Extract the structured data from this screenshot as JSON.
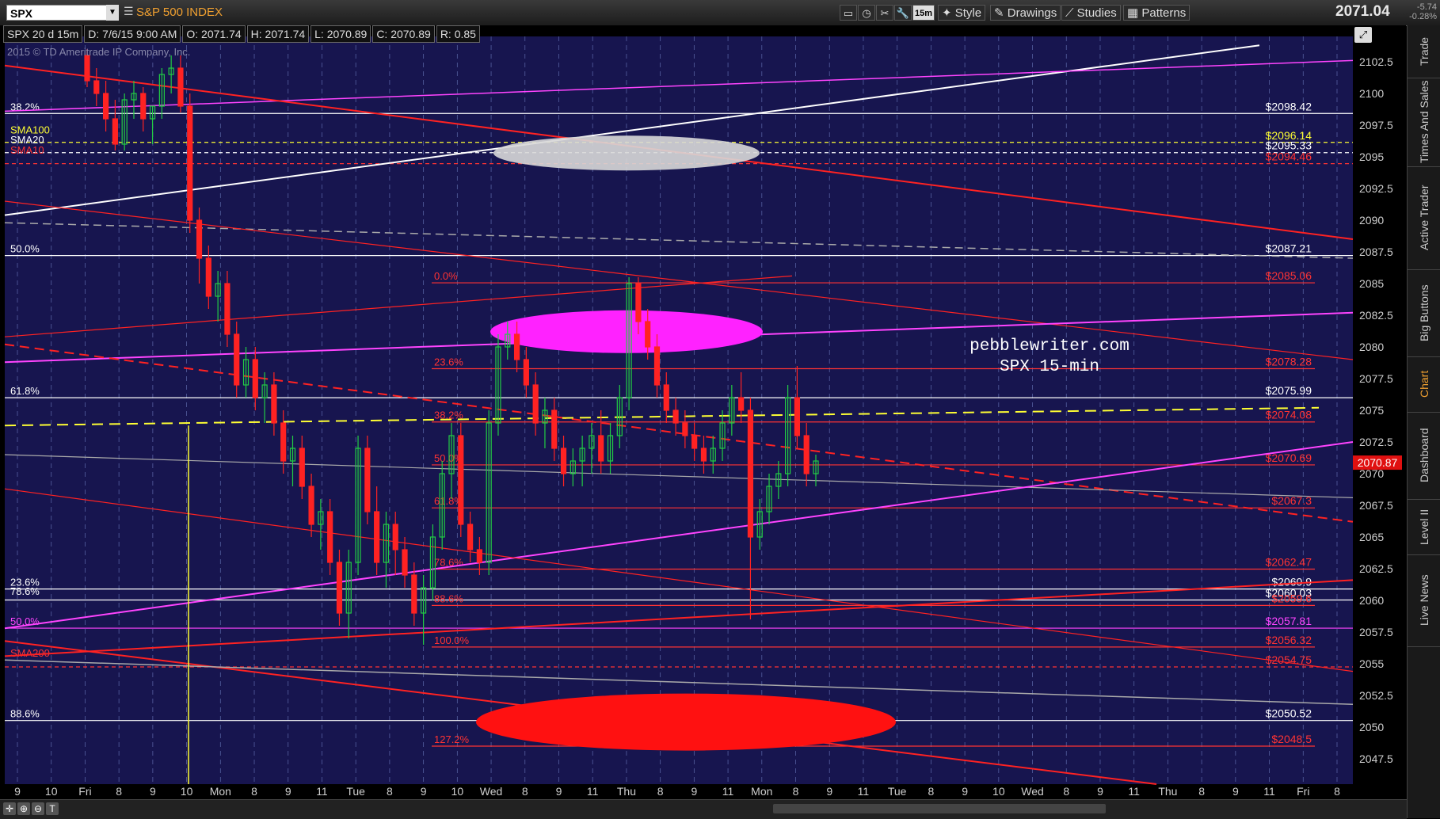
{
  "header": {
    "symbol": "SPX",
    "description": "S&P 500 INDEX",
    "last": "2071.04",
    "change": "-5.74",
    "change_pct": "-0.28%",
    "timeframe_badge": "15m",
    "buttons": [
      "Style",
      "Drawings",
      "Studies",
      "Patterns"
    ]
  },
  "info_bar": {
    "label": "SPX 20 d 15m",
    "date": "D: 7/6/15 9:00 AM",
    "open": "O: 2071.74",
    "high": "H: 2071.74",
    "low": "L: 2070.89",
    "close": "C: 2070.89",
    "range": "R: 0.85"
  },
  "copyright": "2015 © TD Ameritrade IP Company, Inc.",
  "watermark": [
    "pebblewriter.com",
    "SPX 15-min"
  ],
  "right_tabs": [
    "Trade",
    "Times And Sales",
    "Active Trader",
    "Big Buttons",
    "Chart",
    "Dashboard",
    "Level II",
    "Live News"
  ],
  "active_tab": "Chart",
  "chart_data": {
    "type": "candlestick",
    "ylim": [
      2045.5,
      2104
    ],
    "y_ticks": [
      "2047.5",
      "2050",
      "2052.5",
      "2055",
      "2057.5",
      "2060",
      "2062.5",
      "2065",
      "2067.5",
      "2070",
      "2072.5",
      "2075",
      "2077.5",
      "2080",
      "2082.5",
      "2085",
      "2087.5",
      "2090",
      "2092.5",
      "2095",
      "2097.5",
      "2100",
      "2102.5"
    ],
    "x_labels": [
      "9",
      "10",
      "Fri",
      "8",
      "9",
      "10",
      "Mon",
      "8",
      "9",
      "11",
      "Tue",
      "8",
      "9",
      "10",
      "Wed",
      "8",
      "9",
      "11",
      "Thu",
      "8",
      "9",
      "11",
      "Mon",
      "8",
      "9",
      "11",
      "Tue",
      "8",
      "9",
      "10",
      "Wed",
      "8",
      "9",
      "11",
      "Thu",
      "8",
      "9",
      "11",
      "Fri",
      "8"
    ],
    "current_price_label": "2070.87",
    "left_labels": [
      {
        "text": "38.2%",
        "y": 2098.42,
        "color": "#ffffff"
      },
      {
        "text": "SMA100",
        "y": 2096.6,
        "color": "#ffff33"
      },
      {
        "text": "SMA20",
        "y": 2095.8,
        "color": "#ffffff"
      },
      {
        "text": "SMA10",
        "y": 2095.0,
        "color": "#ff3333"
      },
      {
        "text": "50.0%",
        "y": 2087.21,
        "color": "#ffffff"
      },
      {
        "text": "61.8%",
        "y": 2075.99,
        "color": "#ffffff"
      },
      {
        "text": "23.6%",
        "y": 2060.9,
        "color": "#ffffff"
      },
      {
        "text": "78.6%",
        "y": 2060.2,
        "color": "#ffffff"
      },
      {
        "text": "50.0%",
        "y": 2057.81,
        "color": "#ff44ff"
      },
      {
        "text": "SMA200",
        "y": 2055.3,
        "color": "#ff3333"
      },
      {
        "text": "88.6%",
        "y": 2050.52,
        "color": "#ffffff"
      }
    ],
    "fib_labels": [
      {
        "text": "0.0%",
        "y": 2085.06
      },
      {
        "text": "23.6%",
        "y": 2078.28
      },
      {
        "text": "38.2%",
        "y": 2074.08
      },
      {
        "text": "50.0%",
        "y": 2070.69
      },
      {
        "text": "61.8%",
        "y": 2067.3
      },
      {
        "text": "78.6%",
        "y": 2062.47
      },
      {
        "text": "88.6%",
        "y": 2059.6
      },
      {
        "text": "100.0%",
        "y": 2056.32
      },
      {
        "text": "127.2%",
        "y": 2048.5
      }
    ],
    "right_labels": [
      {
        "text": "$2098.42",
        "y": 2098.42,
        "color": "#ffffff"
      },
      {
        "text": "$2096.14",
        "y": 2096.14,
        "color": "#ffff33"
      },
      {
        "text": "$2095.33",
        "y": 2095.33,
        "color": "#ffffff"
      },
      {
        "text": "$2094.46",
        "y": 2094.46,
        "color": "#ff3333"
      },
      {
        "text": "$2087.21",
        "y": 2087.21,
        "color": "#ffffff"
      },
      {
        "text": "$2085.06",
        "y": 2085.06,
        "color": "#ff3333"
      },
      {
        "text": "$2078.28",
        "y": 2078.28,
        "color": "#ff3333"
      },
      {
        "text": "$2075.99",
        "y": 2075.99,
        "color": "#ffffff"
      },
      {
        "text": "$2074.08",
        "y": 2074.08,
        "color": "#ff3333"
      },
      {
        "text": "$2070.69",
        "y": 2070.69,
        "color": "#ff3333"
      },
      {
        "text": "$2067.3",
        "y": 2067.3,
        "color": "#ff3333"
      },
      {
        "text": "$2062.47",
        "y": 2062.47,
        "color": "#ff3333"
      },
      {
        "text": "$2060.9",
        "y": 2060.9,
        "color": "#ffffff"
      },
      {
        "text": "$2060.03",
        "y": 2060.03,
        "color": "#ffffff"
      },
      {
        "text": "$2059.6",
        "y": 2059.6,
        "color": "#ff3333"
      },
      {
        "text": "$2057.81",
        "y": 2057.81,
        "color": "#ff44ff"
      },
      {
        "text": "$2056.32",
        "y": 2056.32,
        "color": "#ff3333"
      },
      {
        "text": "$2054.75",
        "y": 2054.75,
        "color": "#ff3333"
      },
      {
        "text": "$2050.52",
        "y": 2050.52,
        "color": "#ffffff"
      },
      {
        "text": "$2048.5",
        "y": 2048.5,
        "color": "#ff3333"
      }
    ],
    "candles": [
      [
        2103,
        2103.5,
        2100.5,
        2101
      ],
      [
        2101,
        2102,
        2099,
        2100
      ],
      [
        2100,
        2101,
        2097,
        2098
      ],
      [
        2098,
        2099.5,
        2095.5,
        2096
      ],
      [
        2096,
        2100,
        2095.5,
        2099.5
      ],
      [
        2099.5,
        2101,
        2098,
        2100
      ],
      [
        2100,
        2100.5,
        2097,
        2098
      ],
      [
        2098,
        2099,
        2096,
        2099
      ],
      [
        2099,
        2102,
        2098,
        2101.5
      ],
      [
        2101.5,
        2103,
        2100,
        2102
      ],
      [
        2102,
        2103,
        2098.5,
        2099
      ],
      [
        2099,
        2100,
        2089,
        2090
      ],
      [
        2090,
        2091,
        2085,
        2087
      ],
      [
        2087,
        2088,
        2083,
        2084
      ],
      [
        2084,
        2086,
        2082,
        2085
      ],
      [
        2085,
        2086,
        2080,
        2081
      ],
      [
        2081,
        2082,
        2076,
        2077
      ],
      [
        2077,
        2080,
        2076,
        2079
      ],
      [
        2079,
        2080,
        2075,
        2076
      ],
      [
        2076,
        2078,
        2074,
        2077
      ],
      [
        2077,
        2078,
        2073,
        2074
      ],
      [
        2074,
        2075,
        2070,
        2071
      ],
      [
        2071,
        2073,
        2069,
        2072
      ],
      [
        2072,
        2073,
        2068,
        2069
      ],
      [
        2069,
        2070,
        2065,
        2066
      ],
      [
        2066,
        2068,
        2064,
        2067
      ],
      [
        2067,
        2068,
        2062,
        2063
      ],
      [
        2063,
        2064,
        2058,
        2059
      ],
      [
        2059,
        2064,
        2057,
        2063
      ],
      [
        2063,
        2073,
        2062,
        2072
      ],
      [
        2072,
        2073,
        2066,
        2067
      ],
      [
        2067,
        2069,
        2062,
        2063
      ],
      [
        2063,
        2067,
        2061,
        2066
      ],
      [
        2066,
        2067,
        2062,
        2064
      ],
      [
        2064,
        2065,
        2061,
        2062
      ],
      [
        2062,
        2063,
        2058,
        2059
      ],
      [
        2059,
        2062,
        2056.5,
        2061
      ],
      [
        2061,
        2066,
        2060,
        2065
      ],
      [
        2065,
        2071,
        2064,
        2070
      ],
      [
        2070,
        2074,
        2068,
        2073
      ],
      [
        2073,
        2074,
        2065,
        2066
      ],
      [
        2066,
        2067,
        2063,
        2064
      ],
      [
        2064,
        2065,
        2062,
        2063
      ],
      [
        2063,
        2075,
        2062,
        2074
      ],
      [
        2074,
        2081,
        2073,
        2080
      ],
      [
        2080,
        2082,
        2079,
        2081
      ],
      [
        2081,
        2082,
        2078,
        2079
      ],
      [
        2079,
        2080,
        2076,
        2077
      ],
      [
        2077,
        2078,
        2073,
        2074
      ],
      [
        2074,
        2076,
        2072,
        2075
      ],
      [
        2075,
        2076,
        2071,
        2072
      ],
      [
        2072,
        2073,
        2069,
        2070
      ],
      [
        2070,
        2072,
        2069,
        2071
      ],
      [
        2071,
        2073,
        2069,
        2072
      ],
      [
        2072,
        2074,
        2070,
        2073
      ],
      [
        2073,
        2075,
        2070,
        2071
      ],
      [
        2071,
        2074,
        2070,
        2073
      ],
      [
        2073,
        2077,
        2072,
        2076
      ],
      [
        2076,
        2085.5,
        2075,
        2085
      ],
      [
        2085,
        2085.5,
        2081,
        2082
      ],
      [
        2082,
        2083,
        2079,
        2080
      ],
      [
        2080,
        2081,
        2076,
        2077
      ],
      [
        2077,
        2078,
        2074,
        2075
      ],
      [
        2075,
        2076,
        2073,
        2074
      ],
      [
        2074,
        2075,
        2072,
        2073
      ],
      [
        2073,
        2074,
        2071,
        2072
      ],
      [
        2072,
        2073,
        2070,
        2071
      ],
      [
        2071,
        2073,
        2070,
        2072
      ],
      [
        2072,
        2075,
        2071,
        2074
      ],
      [
        2074,
        2077,
        2073,
        2076
      ],
      [
        2076,
        2078,
        2074,
        2075
      ],
      [
        2075,
        2076,
        2058.5,
        2065
      ],
      [
        2065,
        2068,
        2064,
        2067
      ],
      [
        2067,
        2070,
        2066,
        2069
      ],
      [
        2069,
        2071,
        2068,
        2070
      ],
      [
        2070,
        2077,
        2069,
        2076
      ],
      [
        2076,
        2078.5,
        2072,
        2073
      ],
      [
        2073,
        2074,
        2069,
        2070
      ],
      [
        2070,
        2071.5,
        2069,
        2071
      ]
    ]
  }
}
